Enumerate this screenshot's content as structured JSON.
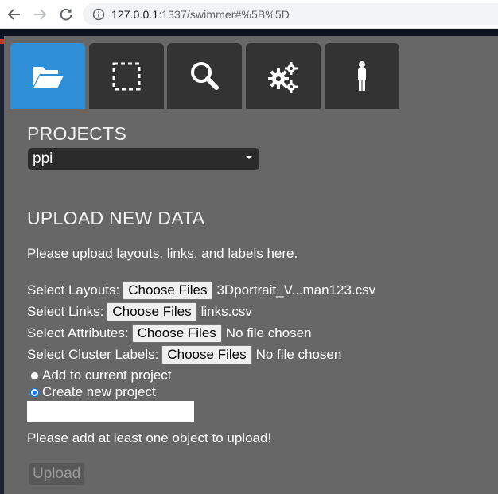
{
  "browser": {
    "url_host": "127.0.0.1",
    "url_path": ":1337/swimmer#%5B%5D"
  },
  "tabs": [
    {
      "icon": "folder-open-icon",
      "active": true
    },
    {
      "icon": "dashed-selection-icon",
      "active": false
    },
    {
      "icon": "search-icon",
      "active": false
    },
    {
      "icon": "gears-icon",
      "active": false
    },
    {
      "icon": "person-icon",
      "active": false
    }
  ],
  "projects": {
    "title": "PROJECTS",
    "selected": "ppi"
  },
  "upload": {
    "title": "UPLOAD NEW DATA",
    "instructions": "Please upload layouts, links, and labels here.",
    "rows": [
      {
        "label": "Select Layouts:",
        "button": "Choose Files",
        "file": "3Dportrait_V...man123.csv"
      },
      {
        "label": "Select Links:",
        "button": "Choose Files",
        "file": "links.csv"
      },
      {
        "label": "Select Attributes:",
        "button": "Choose Files",
        "file": "No file chosen"
      },
      {
        "label": "Select Cluster Labels:",
        "button": "Choose Files",
        "file": "No file chosen"
      }
    ],
    "radio_add": "Add to current project",
    "radio_create": "Create new project",
    "radio_selected": "create",
    "new_project_name": "",
    "warning": "Please add at least one object to upload!",
    "upload_button": "Upload"
  },
  "colors": {
    "panel": "#676767",
    "tab_active": "#2f8fd6",
    "tab_inactive": "#333333"
  }
}
